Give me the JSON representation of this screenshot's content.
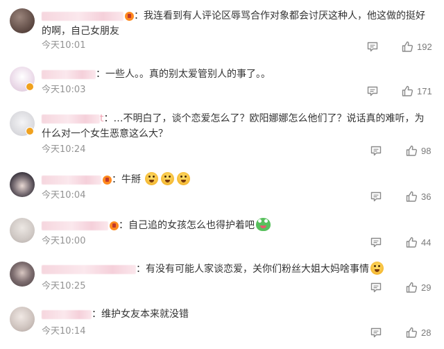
{
  "comments": [
    {
      "avatar_color": "#6e5a55",
      "username_blur_width": 118,
      "separator": "：",
      "text": "我连看到有人评论区辱骂合作对象都会讨厌这种人，他这做的挺好的啊，自己女朋友",
      "time": "今天10:01",
      "likes": "192"
    },
    {
      "avatar_color": "#e8d6e4",
      "username_blur_width": 78,
      "separator": "：",
      "text": "一些人。。真的别太爱管别人的事了。。",
      "time": "今天10:03",
      "likes": "171"
    },
    {
      "avatar_color": "#dcdce0",
      "username_blur_width": 84,
      "handle_tail": "t",
      "separator": "：",
      "text": "…不明白了，谈个恋爱怎么了？欧阳娜娜怎么他们了？说话真的难听，为什么对一个女生恶意这么大？",
      "time": "今天10:24",
      "likes": "98"
    },
    {
      "avatar_color": "#2e2a33",
      "username_blur_width": 86,
      "separator": "：",
      "text": "牛掰",
      "time": "今天10:04",
      "likes": "36"
    },
    {
      "avatar_color": "#cfc8c4",
      "username_blur_width": 96,
      "separator": "：",
      "text": "自己追的女孩怎么也得护着吧",
      "time": "今天10:00",
      "likes": "44"
    },
    {
      "avatar_color": "#5a4d4f",
      "username_blur_width": 136,
      "separator": "：",
      "text": "有没有可能人家谈恋爱，关你们粉丝大姐大妈啥事情",
      "time": "今天10:25",
      "likes": "29"
    },
    {
      "avatar_color": "#cdc2bd",
      "username_blur_width": 72,
      "separator": "：",
      "text": "维护女友本来就没错",
      "time": "今天10:14",
      "likes": "28"
    }
  ],
  "icons": {
    "reply": "reply-icon",
    "like": "thumbs-up-icon",
    "vip": "vip-badge-icon",
    "verified": "verified-badge-icon"
  },
  "colors": {
    "text": "#333333",
    "meta": "#939393",
    "username_blur": "#f6d6de",
    "verified_badge": "#f0a11e"
  }
}
